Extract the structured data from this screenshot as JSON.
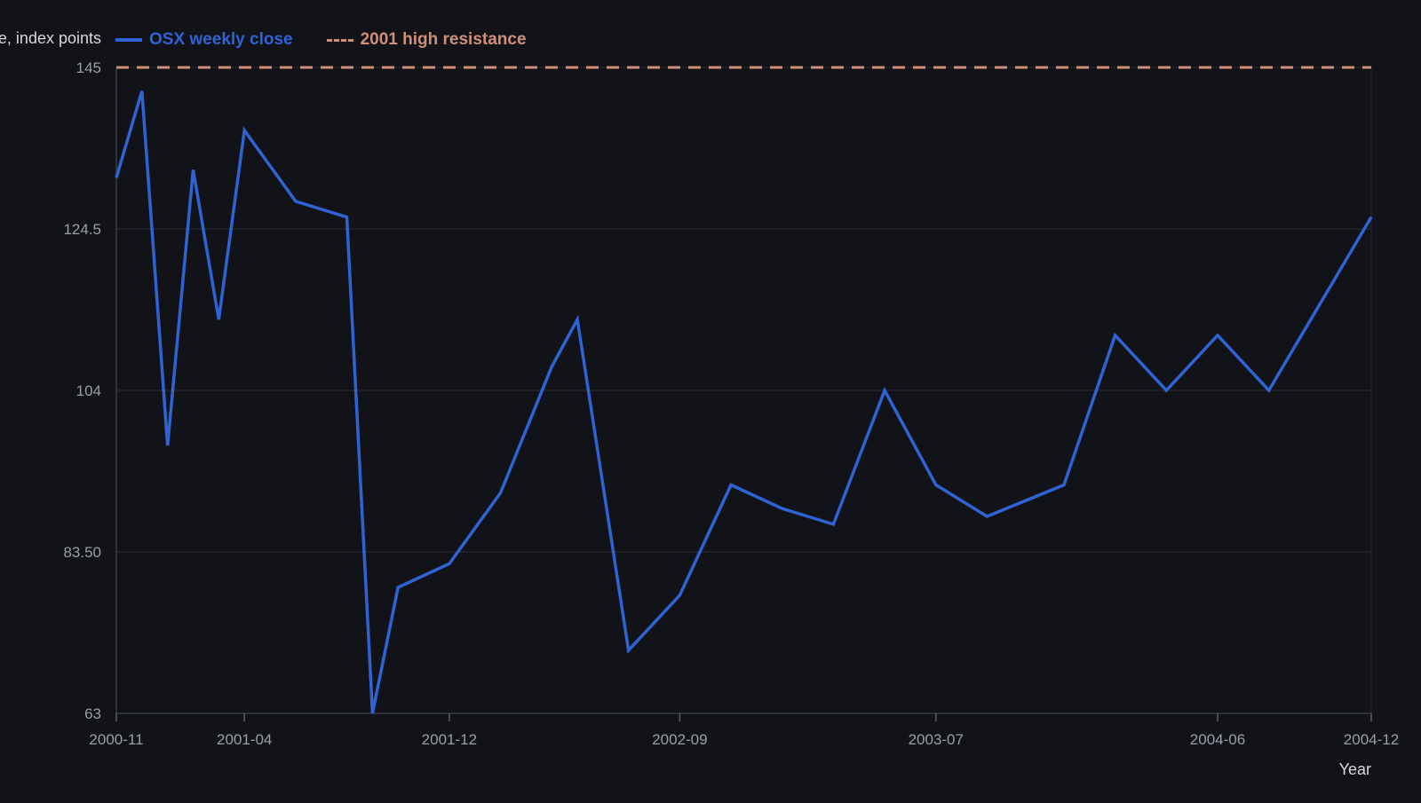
{
  "chart_data": {
    "type": "line",
    "title": "",
    "xlabel": "Year",
    "ylabel": "OSX weekly close, index points",
    "ylim": [
      63,
      145
    ],
    "y_ticks": [
      "63",
      "83.50",
      "104",
      "124.5",
      "145"
    ],
    "x_range": [
      "2000-11",
      "2004-12"
    ],
    "x_ticks": [
      "2000-11",
      "2001-04",
      "2001-12",
      "2002-09",
      "2003-07",
      "2004-06",
      "2004-12"
    ],
    "grid": true,
    "legend_position": "top-left",
    "series": [
      {
        "name": "OSX weekly close",
        "color": "#2f63d4",
        "style": "solid",
        "points": [
          [
            "2000-11",
            131
          ],
          [
            "2000-12",
            142
          ],
          [
            "2001-01",
            97
          ],
          [
            "2001-02",
            132
          ],
          [
            "2001-03",
            113
          ],
          [
            "2001-04",
            137
          ],
          [
            "2001-06",
            128
          ],
          [
            "2001-08",
            126
          ],
          [
            "2001-09",
            63
          ],
          [
            "2001-10",
            79
          ],
          [
            "2001-12",
            82
          ],
          [
            "2002-02",
            91
          ],
          [
            "2002-04",
            107
          ],
          [
            "2002-05",
            113
          ],
          [
            "2002-07",
            71
          ],
          [
            "2002-09",
            78
          ],
          [
            "2002-11",
            92
          ],
          [
            "2003-01",
            89
          ],
          [
            "2003-03",
            87
          ],
          [
            "2003-05",
            104
          ],
          [
            "2003-07",
            92
          ],
          [
            "2003-09",
            88
          ],
          [
            "2003-12",
            92
          ],
          [
            "2004-02",
            111
          ],
          [
            "2004-04",
            104
          ],
          [
            "2004-06",
            111
          ],
          [
            "2004-08",
            104
          ],
          [
            "2004-12",
            126
          ]
        ]
      },
      {
        "name": "2001 high resistance",
        "color": "#cf8f78",
        "style": "dashed",
        "points": [
          [
            "2000-11",
            145
          ],
          [
            "2004-12",
            145
          ]
        ]
      }
    ]
  }
}
